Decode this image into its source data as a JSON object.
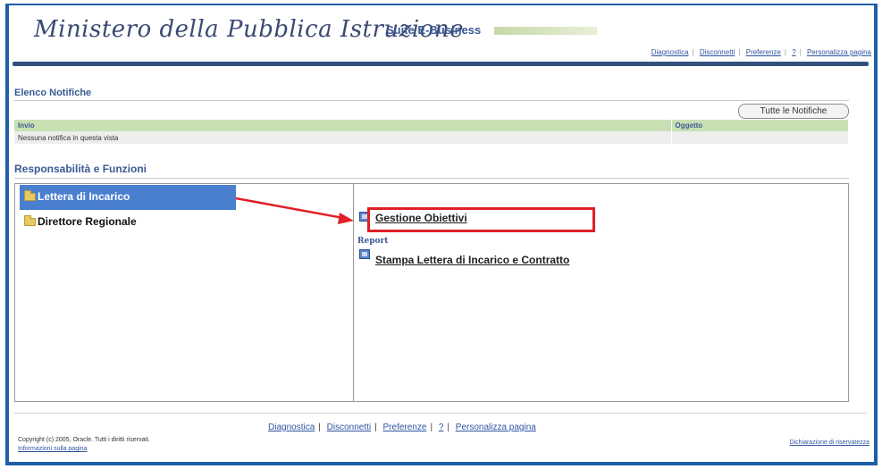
{
  "header": {
    "brand": "Ministero della Pubblica Istruzione",
    "suite": "Suite E-Business",
    "links": [
      "Diagnostica",
      "Disconnetti",
      "Preferenze",
      "?",
      "Personalizza pagina"
    ]
  },
  "notifications": {
    "title": "Elenco Notifiche",
    "button": "Tutte le Notifiche",
    "columns": [
      "Invio",
      "Oggetto"
    ],
    "empty_row": "Nessuna notifica in questa vista"
  },
  "responsibilities": {
    "title": "Responsabilità e Funzioni",
    "items": [
      "Lettera di Incarico",
      "Direttore Regionale"
    ],
    "functions": {
      "item1": "Gestione Obiettivi",
      "section": "Report",
      "item2": "Stampa Lettera di Incarico e Contratto"
    }
  },
  "footer": {
    "links": [
      "Diagnostica",
      "Disconnetti",
      "Preferenze",
      "?",
      "Personalizza pagina"
    ],
    "copyright": "Copyright (c) 2005, Oracle. Tutti i diritti riservati.",
    "page_info": "Informazioni sulla pagina",
    "privacy": "Dichiarazione di riservatezza"
  },
  "colors": {
    "frame": "#1f5ea8",
    "selected": "#4a7fd0",
    "table_header": "#c9e0b4",
    "highlight": "#e01f26"
  }
}
